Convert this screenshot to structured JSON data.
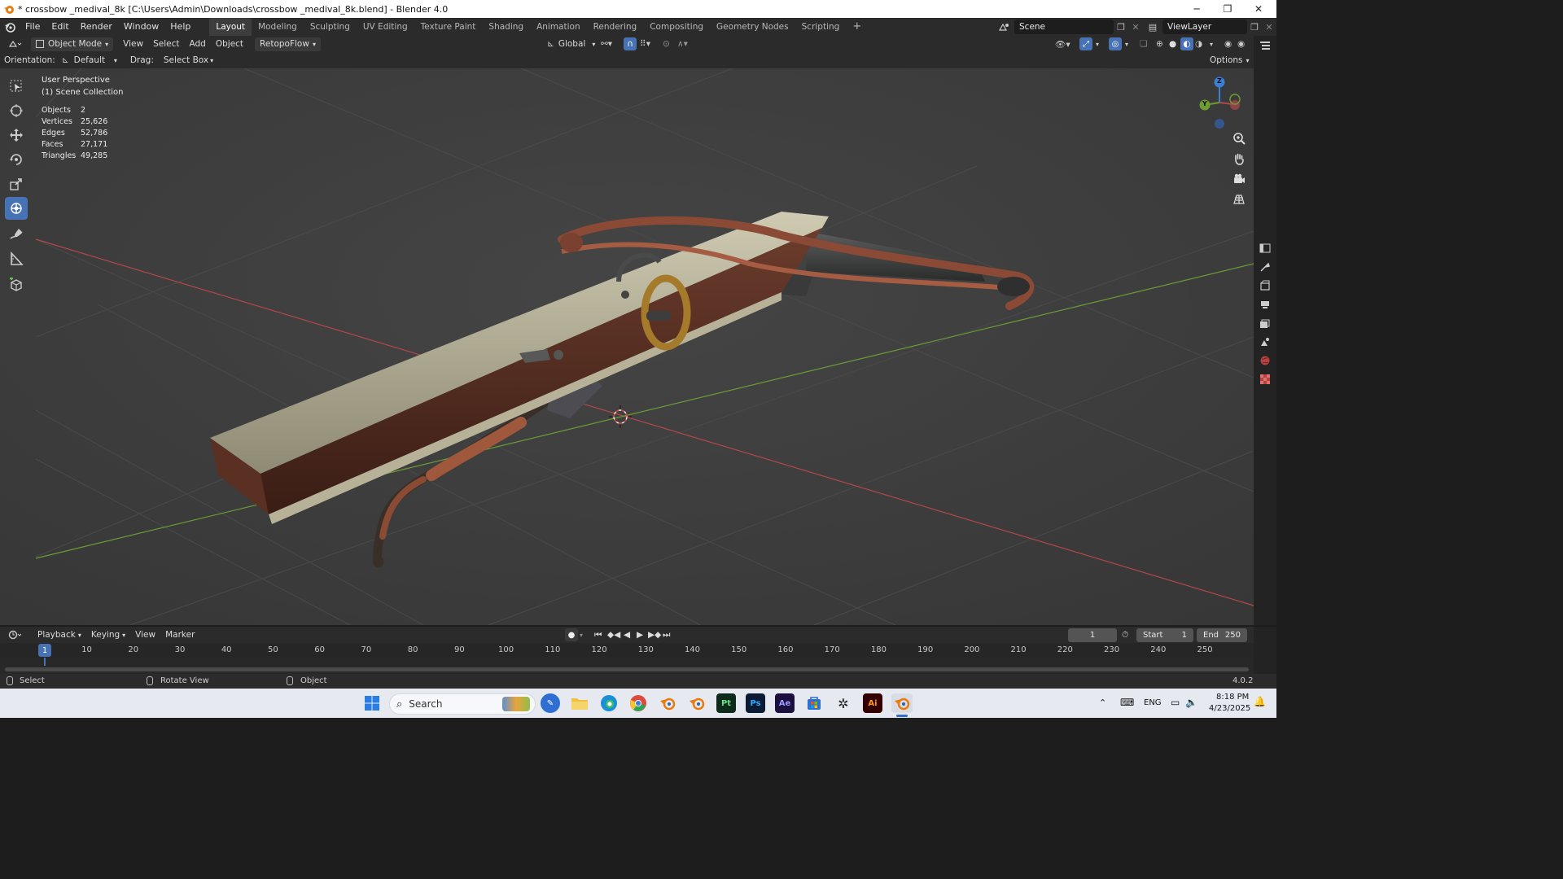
{
  "window": {
    "title": "* crossbow _medival_8k [C:\\Users\\Admin\\Downloads\\crossbow _medival_8k.blend] - Blender 4.0",
    "minimize": "─",
    "maximize": "❐",
    "close": "✕"
  },
  "menu": [
    "File",
    "Edit",
    "Render",
    "Window",
    "Help"
  ],
  "workspaces": [
    "Layout",
    "Modeling",
    "Sculpting",
    "UV Editing",
    "Texture Paint",
    "Shading",
    "Animation",
    "Rendering",
    "Compositing",
    "Geometry Nodes",
    "Scripting"
  ],
  "workspace_add": "+",
  "scene": {
    "name": "Scene",
    "view_layer": "ViewLayer"
  },
  "viewport_header": {
    "mode": "Object Mode",
    "menus": [
      "View",
      "Select",
      "Add",
      "Object"
    ],
    "addon": "RetopoFlow",
    "transform_orientation": "Global",
    "options": "Options"
  },
  "tool_settings": {
    "orientation_label": "Orientation:",
    "orientation_value": "Default",
    "drag_label": "Drag:",
    "drag_value": "Select Box"
  },
  "viewport": {
    "perspective": "User Perspective",
    "collection": "(1) Scene Collection",
    "stats": [
      {
        "label": "Objects",
        "value": "2"
      },
      {
        "label": "Vertices",
        "value": "25,626"
      },
      {
        "label": "Edges",
        "value": "52,786"
      },
      {
        "label": "Faces",
        "value": "27,171"
      },
      {
        "label": "Triangles",
        "value": "49,285"
      }
    ],
    "gizmo": {
      "z": "Z",
      "y": "Y"
    }
  },
  "timeline": {
    "menus": [
      "Playback",
      "Keying",
      "View",
      "Marker"
    ],
    "current_frame": "1",
    "start_label": "Start",
    "start_value": "1",
    "end_label": "End",
    "end_value": "250",
    "ruler": [
      "10",
      "20",
      "30",
      "40",
      "50",
      "60",
      "70",
      "80",
      "90",
      "100",
      "110",
      "120",
      "130",
      "140",
      "150",
      "160",
      "170",
      "180",
      "190",
      "200",
      "210",
      "220",
      "230",
      "240",
      "250"
    ],
    "playhead": "1"
  },
  "statusbar": {
    "select": "Select",
    "rotate": "Rotate View",
    "object": "Object",
    "version": "4.0.2"
  },
  "taskbar": {
    "search_placeholder": "Search",
    "lang": "ENG",
    "time": "8:18 PM",
    "date": "4/23/2025",
    "apps": [
      "Pt",
      "Ps",
      "Ae",
      "Ai"
    ]
  },
  "colors": {
    "accent": "#4772b3",
    "x_axis": "#b3474c",
    "y_axis": "#6c9c34",
    "z_axis": "#3b7fd6"
  }
}
